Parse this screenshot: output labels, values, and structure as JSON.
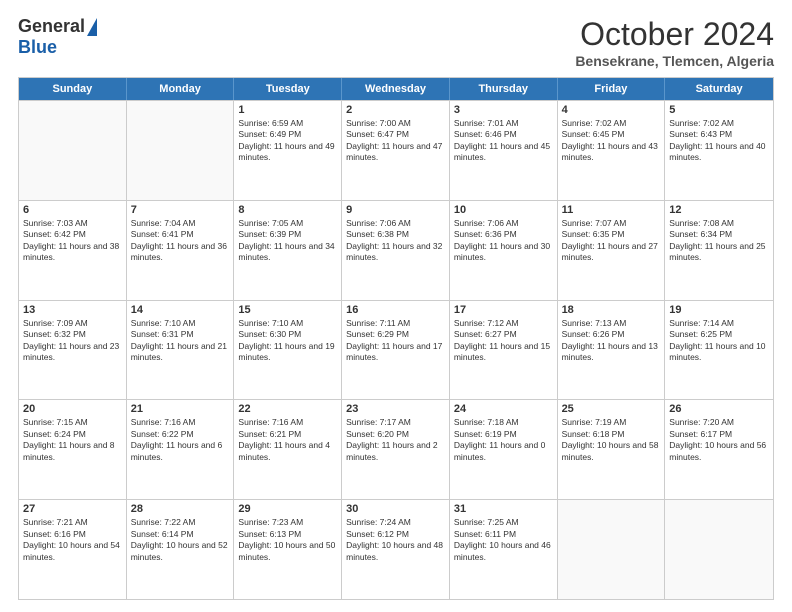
{
  "header": {
    "logo_general": "General",
    "logo_blue": "Blue",
    "month_title": "October 2024",
    "subtitle": "Bensekrane, Tlemcen, Algeria"
  },
  "days": [
    "Sunday",
    "Monday",
    "Tuesday",
    "Wednesday",
    "Thursday",
    "Friday",
    "Saturday"
  ],
  "weeks": [
    [
      {
        "day": "",
        "sunrise": "",
        "sunset": "",
        "daylight": "",
        "empty": true
      },
      {
        "day": "",
        "sunrise": "",
        "sunset": "",
        "daylight": "",
        "empty": true
      },
      {
        "day": "1",
        "sunrise": "Sunrise: 6:59 AM",
        "sunset": "Sunset: 6:49 PM",
        "daylight": "Daylight: 11 hours and 49 minutes."
      },
      {
        "day": "2",
        "sunrise": "Sunrise: 7:00 AM",
        "sunset": "Sunset: 6:47 PM",
        "daylight": "Daylight: 11 hours and 47 minutes."
      },
      {
        "day": "3",
        "sunrise": "Sunrise: 7:01 AM",
        "sunset": "Sunset: 6:46 PM",
        "daylight": "Daylight: 11 hours and 45 minutes."
      },
      {
        "day": "4",
        "sunrise": "Sunrise: 7:02 AM",
        "sunset": "Sunset: 6:45 PM",
        "daylight": "Daylight: 11 hours and 43 minutes."
      },
      {
        "day": "5",
        "sunrise": "Sunrise: 7:02 AM",
        "sunset": "Sunset: 6:43 PM",
        "daylight": "Daylight: 11 hours and 40 minutes."
      }
    ],
    [
      {
        "day": "6",
        "sunrise": "Sunrise: 7:03 AM",
        "sunset": "Sunset: 6:42 PM",
        "daylight": "Daylight: 11 hours and 38 minutes."
      },
      {
        "day": "7",
        "sunrise": "Sunrise: 7:04 AM",
        "sunset": "Sunset: 6:41 PM",
        "daylight": "Daylight: 11 hours and 36 minutes."
      },
      {
        "day": "8",
        "sunrise": "Sunrise: 7:05 AM",
        "sunset": "Sunset: 6:39 PM",
        "daylight": "Daylight: 11 hours and 34 minutes."
      },
      {
        "day": "9",
        "sunrise": "Sunrise: 7:06 AM",
        "sunset": "Sunset: 6:38 PM",
        "daylight": "Daylight: 11 hours and 32 minutes."
      },
      {
        "day": "10",
        "sunrise": "Sunrise: 7:06 AM",
        "sunset": "Sunset: 6:36 PM",
        "daylight": "Daylight: 11 hours and 30 minutes."
      },
      {
        "day": "11",
        "sunrise": "Sunrise: 7:07 AM",
        "sunset": "Sunset: 6:35 PM",
        "daylight": "Daylight: 11 hours and 27 minutes."
      },
      {
        "day": "12",
        "sunrise": "Sunrise: 7:08 AM",
        "sunset": "Sunset: 6:34 PM",
        "daylight": "Daylight: 11 hours and 25 minutes."
      }
    ],
    [
      {
        "day": "13",
        "sunrise": "Sunrise: 7:09 AM",
        "sunset": "Sunset: 6:32 PM",
        "daylight": "Daylight: 11 hours and 23 minutes."
      },
      {
        "day": "14",
        "sunrise": "Sunrise: 7:10 AM",
        "sunset": "Sunset: 6:31 PM",
        "daylight": "Daylight: 11 hours and 21 minutes."
      },
      {
        "day": "15",
        "sunrise": "Sunrise: 7:10 AM",
        "sunset": "Sunset: 6:30 PM",
        "daylight": "Daylight: 11 hours and 19 minutes."
      },
      {
        "day": "16",
        "sunrise": "Sunrise: 7:11 AM",
        "sunset": "Sunset: 6:29 PM",
        "daylight": "Daylight: 11 hours and 17 minutes."
      },
      {
        "day": "17",
        "sunrise": "Sunrise: 7:12 AM",
        "sunset": "Sunset: 6:27 PM",
        "daylight": "Daylight: 11 hours and 15 minutes."
      },
      {
        "day": "18",
        "sunrise": "Sunrise: 7:13 AM",
        "sunset": "Sunset: 6:26 PM",
        "daylight": "Daylight: 11 hours and 13 minutes."
      },
      {
        "day": "19",
        "sunrise": "Sunrise: 7:14 AM",
        "sunset": "Sunset: 6:25 PM",
        "daylight": "Daylight: 11 hours and 10 minutes."
      }
    ],
    [
      {
        "day": "20",
        "sunrise": "Sunrise: 7:15 AM",
        "sunset": "Sunset: 6:24 PM",
        "daylight": "Daylight: 11 hours and 8 minutes."
      },
      {
        "day": "21",
        "sunrise": "Sunrise: 7:16 AM",
        "sunset": "Sunset: 6:22 PM",
        "daylight": "Daylight: 11 hours and 6 minutes."
      },
      {
        "day": "22",
        "sunrise": "Sunrise: 7:16 AM",
        "sunset": "Sunset: 6:21 PM",
        "daylight": "Daylight: 11 hours and 4 minutes."
      },
      {
        "day": "23",
        "sunrise": "Sunrise: 7:17 AM",
        "sunset": "Sunset: 6:20 PM",
        "daylight": "Daylight: 11 hours and 2 minutes."
      },
      {
        "day": "24",
        "sunrise": "Sunrise: 7:18 AM",
        "sunset": "Sunset: 6:19 PM",
        "daylight": "Daylight: 11 hours and 0 minutes."
      },
      {
        "day": "25",
        "sunrise": "Sunrise: 7:19 AM",
        "sunset": "Sunset: 6:18 PM",
        "daylight": "Daylight: 10 hours and 58 minutes."
      },
      {
        "day": "26",
        "sunrise": "Sunrise: 7:20 AM",
        "sunset": "Sunset: 6:17 PM",
        "daylight": "Daylight: 10 hours and 56 minutes."
      }
    ],
    [
      {
        "day": "27",
        "sunrise": "Sunrise: 7:21 AM",
        "sunset": "Sunset: 6:16 PM",
        "daylight": "Daylight: 10 hours and 54 minutes."
      },
      {
        "day": "28",
        "sunrise": "Sunrise: 7:22 AM",
        "sunset": "Sunset: 6:14 PM",
        "daylight": "Daylight: 10 hours and 52 minutes."
      },
      {
        "day": "29",
        "sunrise": "Sunrise: 7:23 AM",
        "sunset": "Sunset: 6:13 PM",
        "daylight": "Daylight: 10 hours and 50 minutes."
      },
      {
        "day": "30",
        "sunrise": "Sunrise: 7:24 AM",
        "sunset": "Sunset: 6:12 PM",
        "daylight": "Daylight: 10 hours and 48 minutes."
      },
      {
        "day": "31",
        "sunrise": "Sunrise: 7:25 AM",
        "sunset": "Sunset: 6:11 PM",
        "daylight": "Daylight: 10 hours and 46 minutes."
      },
      {
        "day": "",
        "sunrise": "",
        "sunset": "",
        "daylight": "",
        "empty": true
      },
      {
        "day": "",
        "sunrise": "",
        "sunset": "",
        "daylight": "",
        "empty": true
      }
    ]
  ]
}
